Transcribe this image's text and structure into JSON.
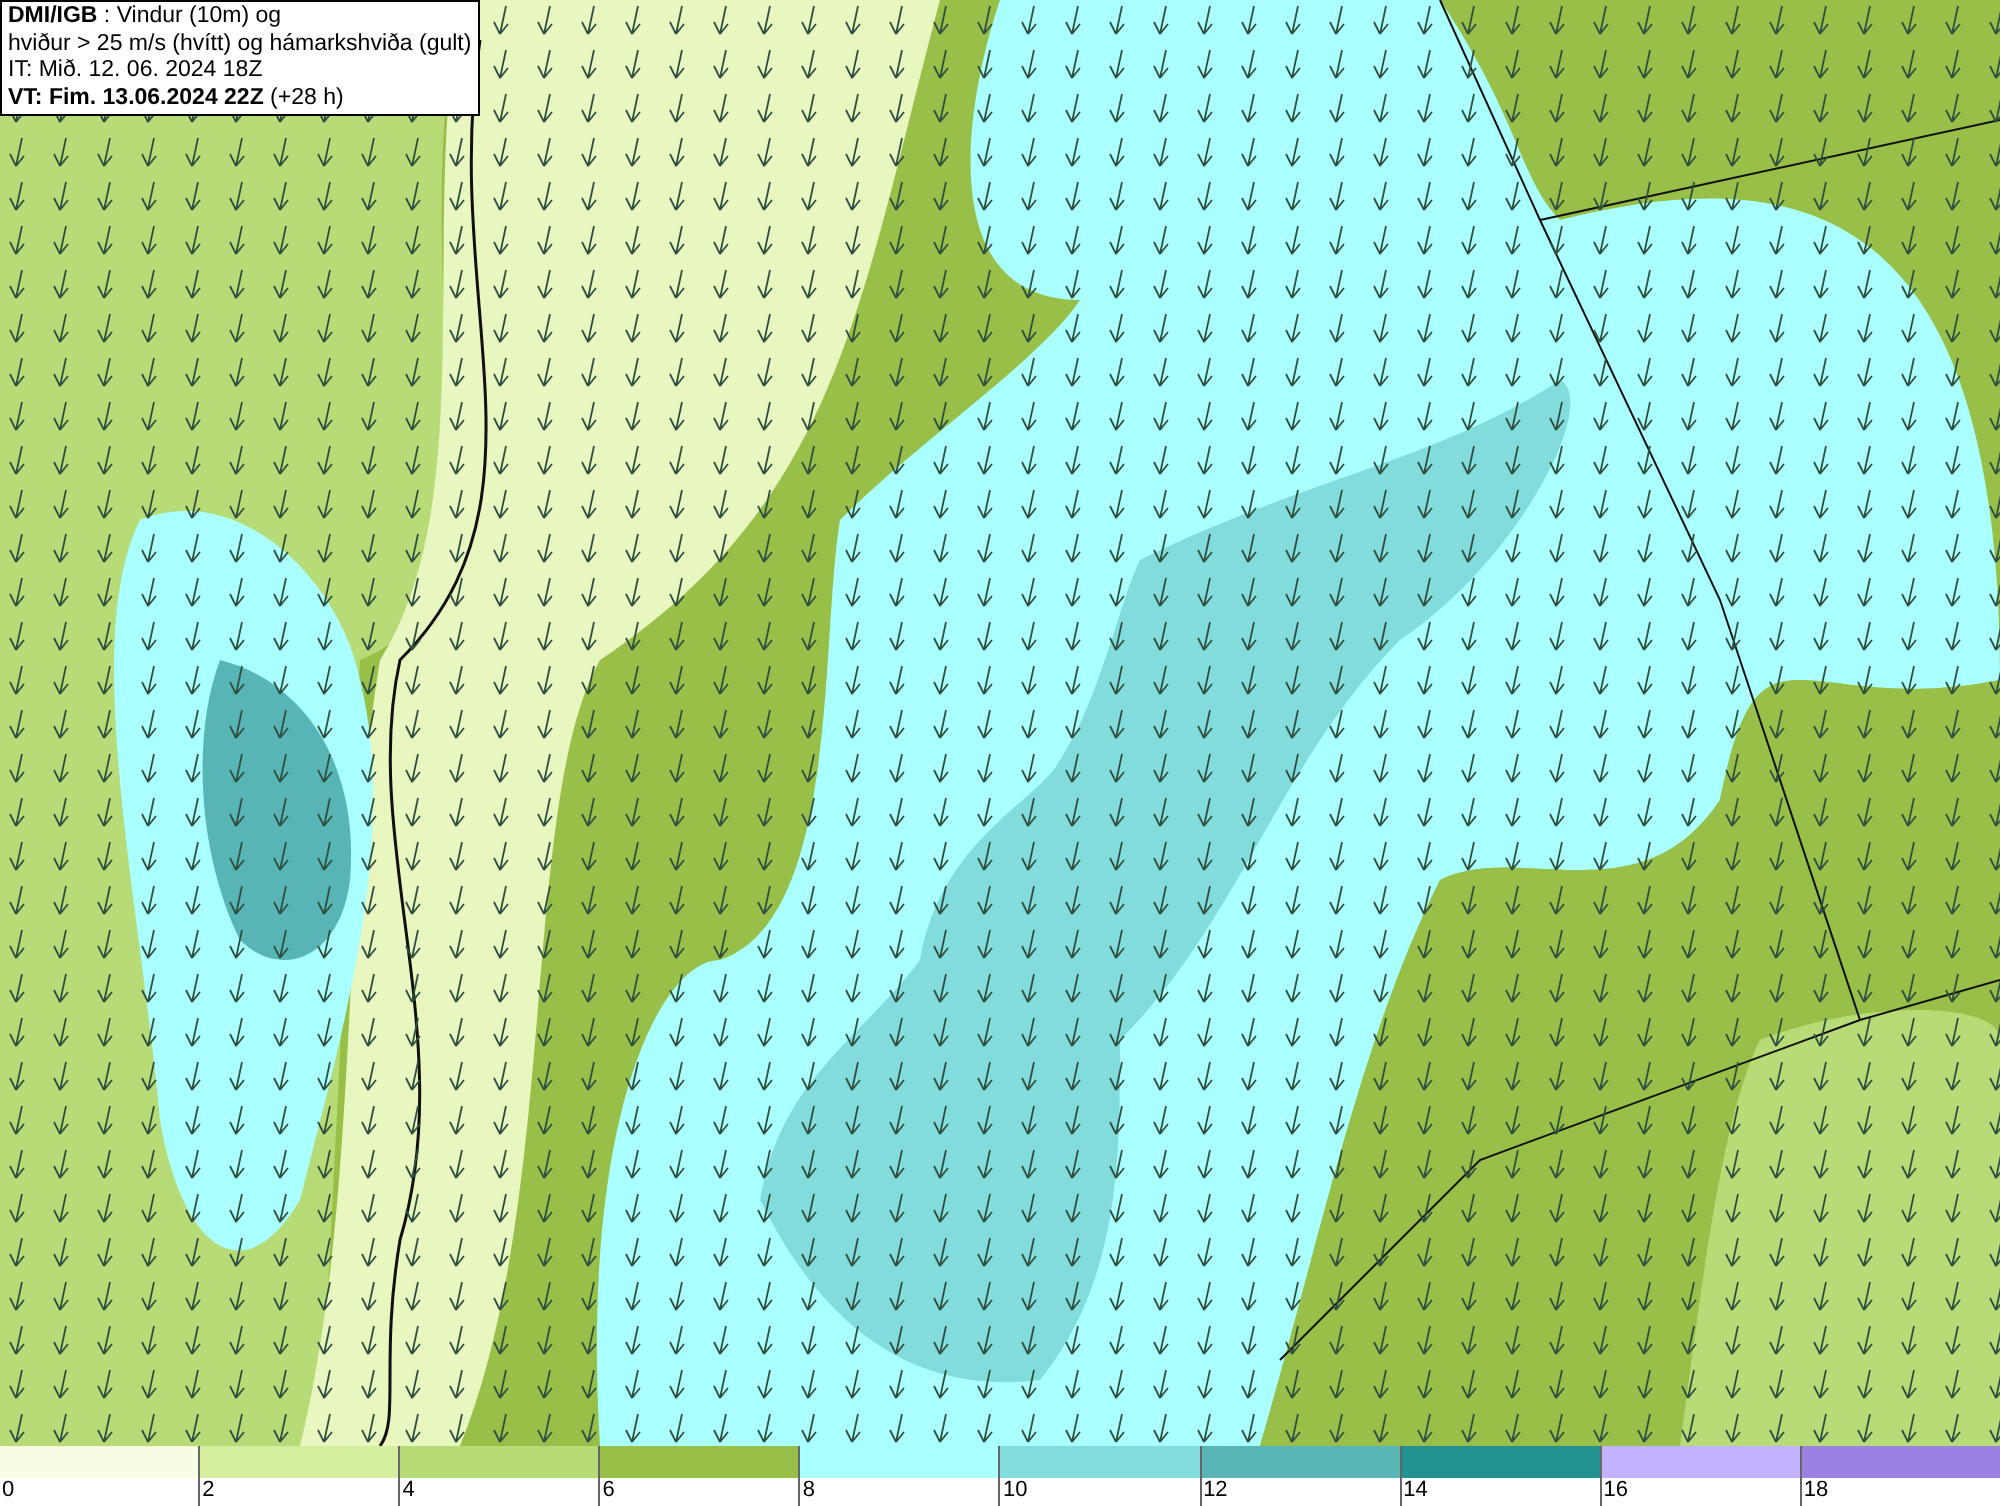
{
  "header": {
    "lines": [
      "**DMI/IGB** : Vindur (10m) og",
      "hviður > 25 m/s (hvítt) og hámarkshviða (gult)",
      "IT: Mið. 12. 06. 2024 18Z",
      "**VT: Fim. 13.06.2024 22Z** (+28 h)"
    ]
  },
  "legend": [
    {
      "label": "0",
      "color": "#f6fde2"
    },
    {
      "label": "2",
      "color": "#d5ee9e"
    },
    {
      "label": "4",
      "color": "#b7db76"
    },
    {
      "label": "6",
      "color": "#98c048"
    },
    {
      "label": "8",
      "color": "#aaffff"
    },
    {
      "label": "10",
      "color": "#82dcdc"
    },
    {
      "label": "12",
      "color": "#57b5b5"
    },
    {
      "label": "14",
      "color": "#239292"
    },
    {
      "label": "16",
      "color": "#c2b2ff"
    },
    {
      "label": "18",
      "color": "#9b82e2"
    }
  ]
}
